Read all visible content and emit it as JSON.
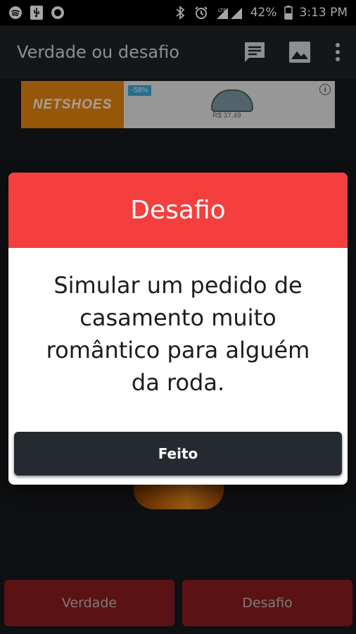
{
  "status_bar": {
    "battery_percent": "42%",
    "time": "3:13 PM",
    "network": "LTE",
    "left_icons": [
      "spotify-icon",
      "usb-icon",
      "record-icon"
    ],
    "right_icons": [
      "bluetooth-icon",
      "alarm-icon",
      "signal-icon",
      "battery-icon"
    ]
  },
  "toolbar": {
    "title": "Verdade ou desafio",
    "icons": [
      "chat-icon",
      "image-icon",
      "more-vert-icon"
    ]
  },
  "ad": {
    "brand": "NETSHOES",
    "discount": "-58%",
    "price": "R$ 37,49"
  },
  "dialog": {
    "title": "Desafio",
    "message": "Simular um pedido de casamento muito romântico para alguém da roda.",
    "done_label": "Feito"
  },
  "bottom_buttons": {
    "truth_label": "Verdade",
    "dare_label": "Desafio"
  },
  "colors": {
    "dialog_header": "#f43f3e",
    "toolbar": "#1f2328",
    "bottom_buttons": "#8c1d1f",
    "done_button": "#252a31"
  }
}
